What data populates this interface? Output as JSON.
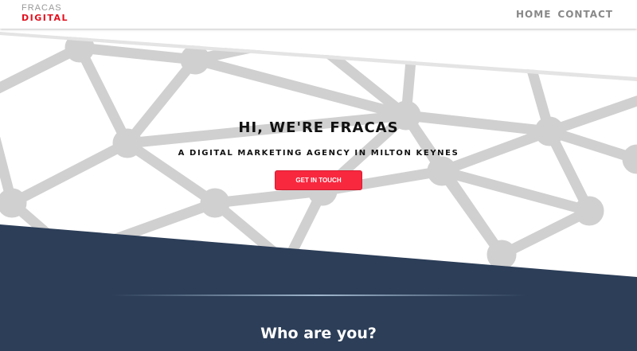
{
  "header": {
    "logo_top": "FRACAS",
    "logo_bottom": "DIGITAL",
    "nav": [
      {
        "label": "HOME"
      },
      {
        "label": "CONTACT"
      }
    ]
  },
  "hero": {
    "title": "HI, WE'RE FRACAS",
    "subtitle": "A DIGITAL MARKETING AGENCY IN MILTON KEYNES",
    "cta": "GET IN TOUCH"
  },
  "section": {
    "heading": "Who are you?"
  },
  "colors": {
    "accent": "#f8283f",
    "navy": "#2c3e58",
    "network": "#d0d0d0",
    "logo_red": "#e3101e"
  }
}
